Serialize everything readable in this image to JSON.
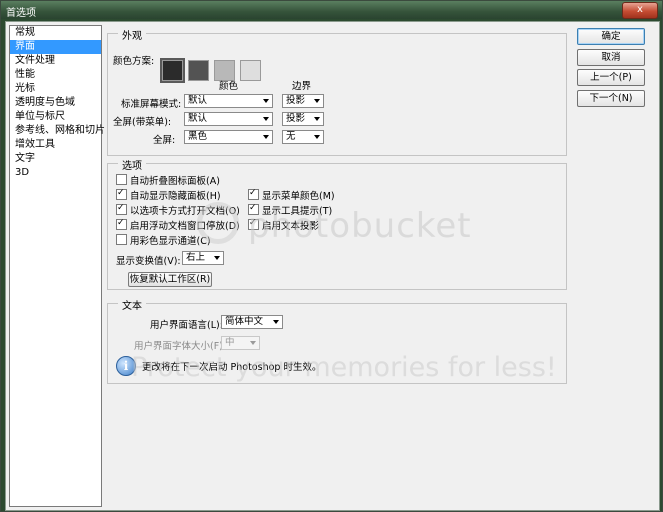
{
  "window": {
    "title": "首选项",
    "close_glyph": "x"
  },
  "sidebar": {
    "items": [
      "常规",
      "界面",
      "文件处理",
      "性能",
      "光标",
      "透明度与色域",
      "单位与标尺",
      "参考线、网格和切片",
      "增效工具",
      "文字",
      "3D"
    ],
    "selected_index": 1
  },
  "buttons": {
    "ok": "确定",
    "cancel": "取消",
    "prev": "上一个(P)",
    "next": "下一个(N)"
  },
  "appearance": {
    "legend": "外观",
    "color_scheme_label": "颜色方案:",
    "swatches": [
      "#2b2b2b",
      "#535353",
      "#b8b8b8",
      "#dedede"
    ],
    "col_color": "颜色",
    "col_border": "边界",
    "rows": [
      {
        "label": "标准屏幕模式:",
        "color": "默认",
        "border": "投影"
      },
      {
        "label": "全屏(带菜单):",
        "color": "默认",
        "border": "投影"
      },
      {
        "label": "全屏:",
        "color": "黑色",
        "border": "无"
      }
    ]
  },
  "options": {
    "legend": "选项",
    "left": [
      {
        "label": "自动折叠图标面板(A)",
        "checked": false
      },
      {
        "label": "自动显示隐藏面板(H)",
        "checked": true
      },
      {
        "label": "以选项卡方式打开文档(O)",
        "checked": true
      },
      {
        "label": "启用浮动文档窗口停放(D)",
        "checked": true
      },
      {
        "label": "用彩色显示通道(C)",
        "checked": false
      }
    ],
    "right": [
      {
        "label": "显示菜单颜色(M)",
        "checked": true
      },
      {
        "label": "显示工具提示(T)",
        "checked": true
      },
      {
        "label": "启用文本投影",
        "checked": true
      }
    ],
    "transform_label": "显示变换值(V):",
    "transform_value": "右上",
    "reset_button": "恢复默认工作区(R)"
  },
  "text": {
    "legend": "文本",
    "ui_language_label": "用户界面语言(L):",
    "ui_language_value": "简体中文",
    "ui_font_size_label": "用户界面字体大小(F):",
    "ui_font_size_value": "中",
    "info_note": "更改将在下一次启动 Photoshop 时生效。"
  },
  "watermark": {
    "line1": "photobucket",
    "line2": "Protect your memories for less!"
  }
}
